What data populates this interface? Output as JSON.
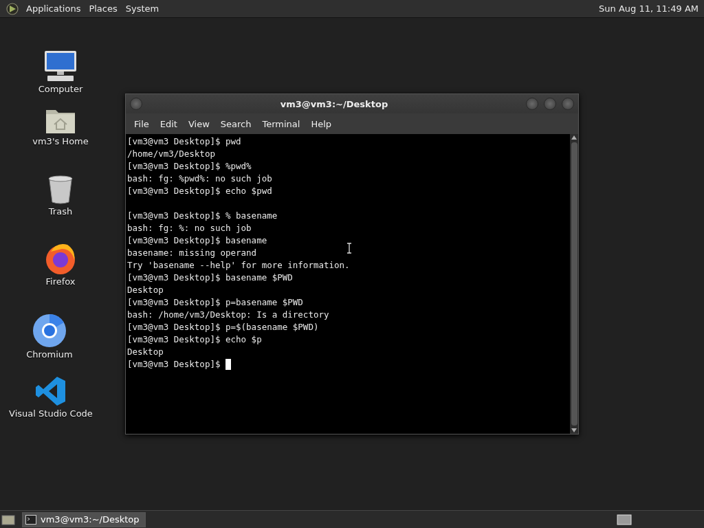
{
  "top_panel": {
    "menus": [
      "Applications",
      "Places",
      "System"
    ],
    "clock": "Sun Aug 11, 11:49 AM"
  },
  "desktop_icons": [
    {
      "kind": "computer",
      "label": "Computer"
    },
    {
      "kind": "home",
      "label": "vm3's Home"
    },
    {
      "kind": "trash",
      "label": "Trash"
    },
    {
      "kind": "firefox",
      "label": "Firefox"
    },
    {
      "kind": "chromium",
      "label": "Chromium"
    },
    {
      "kind": "vscode",
      "label": "Visual Studio Code"
    }
  ],
  "terminal": {
    "title": "vm3@vm3:~/Desktop",
    "menu": [
      "File",
      "Edit",
      "View",
      "Search",
      "Terminal",
      "Help"
    ],
    "blocks": [
      [
        "[vm3@vm3 Desktop]$ pwd",
        "/home/vm3/Desktop",
        "[vm3@vm3 Desktop]$ %pwd%",
        "bash: fg: %pwd%: no such job",
        "[vm3@vm3 Desktop]$ echo $pwd"
      ],
      [
        "[vm3@vm3 Desktop]$ % basename",
        "bash: fg: %: no such job",
        "[vm3@vm3 Desktop]$ basename",
        "basename: missing operand",
        "Try 'basename --help' for more information.",
        "[vm3@vm3 Desktop]$ basename $PWD",
        "Desktop",
        "[vm3@vm3 Desktop]$ p=basename $PWD",
        "bash: /home/vm3/Desktop: Is a directory",
        "[vm3@vm3 Desktop]$ p=$(basename $PWD)",
        "[vm3@vm3 Desktop]$ echo $p",
        "Desktop",
        "[vm3@vm3 Desktop]$ "
      ]
    ]
  },
  "taskbar": {
    "tasks": [
      {
        "label": "vm3@vm3:~/Desktop",
        "selected": true
      }
    ]
  }
}
